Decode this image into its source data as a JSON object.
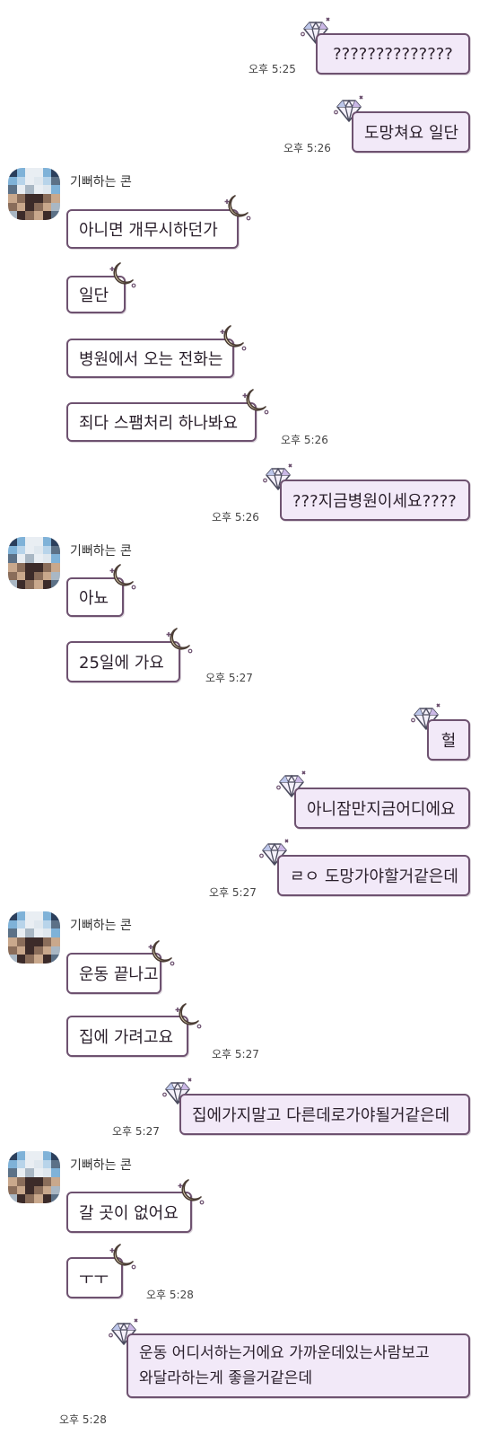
{
  "contact_name": "기뻐하는 콘",
  "colors": {
    "my_bubble": "#f2e9f8",
    "their_bubble": "#ffffff",
    "bubble_border": "#6e5270"
  },
  "icons": {
    "me": "diamond-icon",
    "them": "moon-icon"
  },
  "messages": [
    {
      "sender": "me",
      "text": "??????????????",
      "time": "오후 5:25"
    },
    {
      "sender": "me",
      "text": "도망쳐요 일단",
      "time": "오후 5:26"
    },
    {
      "sender": "them",
      "text": "아니면 개무시하던가"
    },
    {
      "sender": "them",
      "text": "일단"
    },
    {
      "sender": "them",
      "text": "병원에서 오는 전화는"
    },
    {
      "sender": "them",
      "text": "죄다 스팸처리 하나봐요",
      "time": "오후 5:26"
    },
    {
      "sender": "me",
      "text": "???지금병원이세요????",
      "time": "오후 5:26"
    },
    {
      "sender": "them",
      "text": "아뇨"
    },
    {
      "sender": "them",
      "text": "25일에 가요",
      "time": "오후 5:27"
    },
    {
      "sender": "me",
      "text": "헐"
    },
    {
      "sender": "me",
      "text": "아니잠만지금어디에요"
    },
    {
      "sender": "me",
      "text": "ㄹㅇ 도망가야할거같은데",
      "time": "오후 5:27"
    },
    {
      "sender": "them",
      "text": "운동 끝나고"
    },
    {
      "sender": "them",
      "text": "집에 가려고요",
      "time": "오후 5:27"
    },
    {
      "sender": "me",
      "text": "집에가지말고 다른데로가야될거같은데",
      "time": "오후 5:27"
    },
    {
      "sender": "them",
      "text": "갈 곳이 없어요"
    },
    {
      "sender": "them",
      "text": "ㅜㅜ",
      "time": "오후 5:28"
    },
    {
      "sender": "me",
      "lines": [
        "운동 어디서하는거에요 가까운데있는사람보고",
        "와달라하는게 좋을거같은데"
      ],
      "time": "오후 5:28"
    }
  ]
}
